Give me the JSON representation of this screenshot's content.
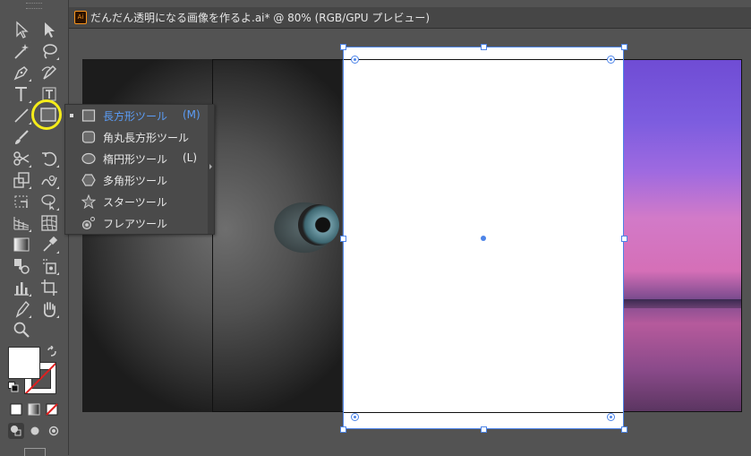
{
  "document": {
    "tab_title": "だんだん透明になる画像を作るよ.ai* @ 80% (RGB/GPU プレビュー)",
    "app_badge": "Ai"
  },
  "toolbar": {
    "tools": [
      "selection-tool",
      "direct-selection-tool",
      "magic-wand-tool",
      "lasso-tool",
      "pen-tool",
      "curvature-tool",
      "type-tool",
      "touch-type-tool",
      "line-segment-tool",
      "rectangle-tool",
      "paintbrush-tool",
      "shaper-tool",
      "scissors-tool",
      "rotate-tool",
      "scale-tool",
      "warp-tool",
      "free-transform-tool",
      "shape-builder-tool",
      "perspective-grid-tool",
      "mesh-tool",
      "gradient-tool",
      "eyedropper-tool",
      "blend-tool",
      "symbol-sprayer-tool",
      "column-graph-tool",
      "artboard-tool",
      "slice-tool",
      "hand-tool",
      "zoom-tool"
    ],
    "active_tool": "rectangle-tool",
    "fill_color": "#ffffff",
    "stroke_color": "none",
    "highlight_color": "#f5ec1a"
  },
  "flyout": {
    "items": [
      {
        "label": "長方形ツール",
        "shortcut": "(M)",
        "icon": "rectangle-icon",
        "selected": true
      },
      {
        "label": "角丸長方形ツール",
        "shortcut": "",
        "icon": "rounded-rectangle-icon",
        "selected": false
      },
      {
        "label": "楕円形ツール",
        "shortcut": "(L)",
        "icon": "ellipse-icon",
        "selected": false
      },
      {
        "label": "多角形ツール",
        "shortcut": "",
        "icon": "polygon-icon",
        "selected": false
      },
      {
        "label": "スターツール",
        "shortcut": "",
        "icon": "star-icon",
        "selected": false
      },
      {
        "label": "フレアツール",
        "shortcut": "",
        "icon": "flare-icon",
        "selected": false
      }
    ],
    "selected_color": "#5b9cf5"
  },
  "canvas": {
    "selection_color": "#4d84e8",
    "images": [
      "cat-photo",
      "sunset-photo"
    ]
  }
}
